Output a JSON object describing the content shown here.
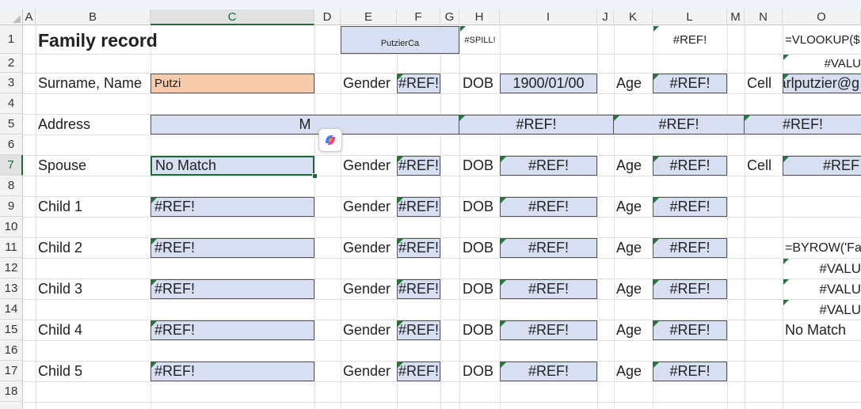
{
  "columns": [
    "A",
    "B",
    "C",
    "D",
    "E",
    "F",
    "G",
    "H",
    "I",
    "J",
    "K",
    "L",
    "M",
    "N",
    "O"
  ],
  "rows": [
    "1",
    "2",
    "3",
    "4",
    "5",
    "6",
    "7",
    "8",
    "9",
    "10",
    "11",
    "12",
    "13",
    "14",
    "15",
    "16",
    "17",
    "18"
  ],
  "title": "Family record",
  "top_row": {
    "name_code": "PutzierCa",
    "spill": "#SPILL!",
    "ref": "#REF!",
    "vlookup_formula": "=VLOOKUP($",
    "value_error": "#VALU"
  },
  "labels": {
    "gender": "Gender",
    "dob": "DOB",
    "age": "Age",
    "cell": "Cell"
  },
  "person": {
    "label": "Surname, Name",
    "name_value": "Putzi",
    "gender": "#REF!",
    "dob": "1900/01/00",
    "age": "#REF!",
    "email": "arlputzier@g"
  },
  "address": {
    "label": "Address",
    "value": "M",
    "ref1": "#REF!",
    "ref2": "#REF!",
    "ref3": "#REF!"
  },
  "spouse": {
    "label": "Spouse",
    "value": "No Match",
    "gender": "#REF!",
    "dob": "#REF!",
    "age": "#REF!",
    "cell": "#REF"
  },
  "children": [
    {
      "label": "Child 1",
      "value": "#REF!",
      "gender": "#REF!",
      "dob": "#REF!",
      "age": "#REF!"
    },
    {
      "label": "Child 2",
      "value": "#REF!",
      "gender": "#REF!",
      "dob": "#REF!",
      "age": "#REF!"
    },
    {
      "label": "Child 3",
      "value": "#REF!",
      "gender": "#REF!",
      "dob": "#REF!",
      "age": "#REF!"
    },
    {
      "label": "Child 4",
      "value": "#REF!",
      "gender": "#REF!",
      "dob": "#REF!",
      "age": "#REF!"
    },
    {
      "label": "Child 5",
      "value": "#REF!",
      "gender": "#REF!",
      "dob": "#REF!",
      "age": "#REF!"
    }
  ],
  "side_column": {
    "byrow_formula": "=BYROW('Fa",
    "value_error_1": "#VALU",
    "value_error_2": "#VALU",
    "value_error_3": "#VALU",
    "no_match": "No Match"
  },
  "colors": {
    "input_fill": "#d9dff2",
    "name_fill": "#f8cbad",
    "error_triangle": "#1e7b3a",
    "selection": "#1e6b3a",
    "header_bg": "#f3f3f3"
  },
  "icons": {
    "copilot": "copilot-icon"
  }
}
